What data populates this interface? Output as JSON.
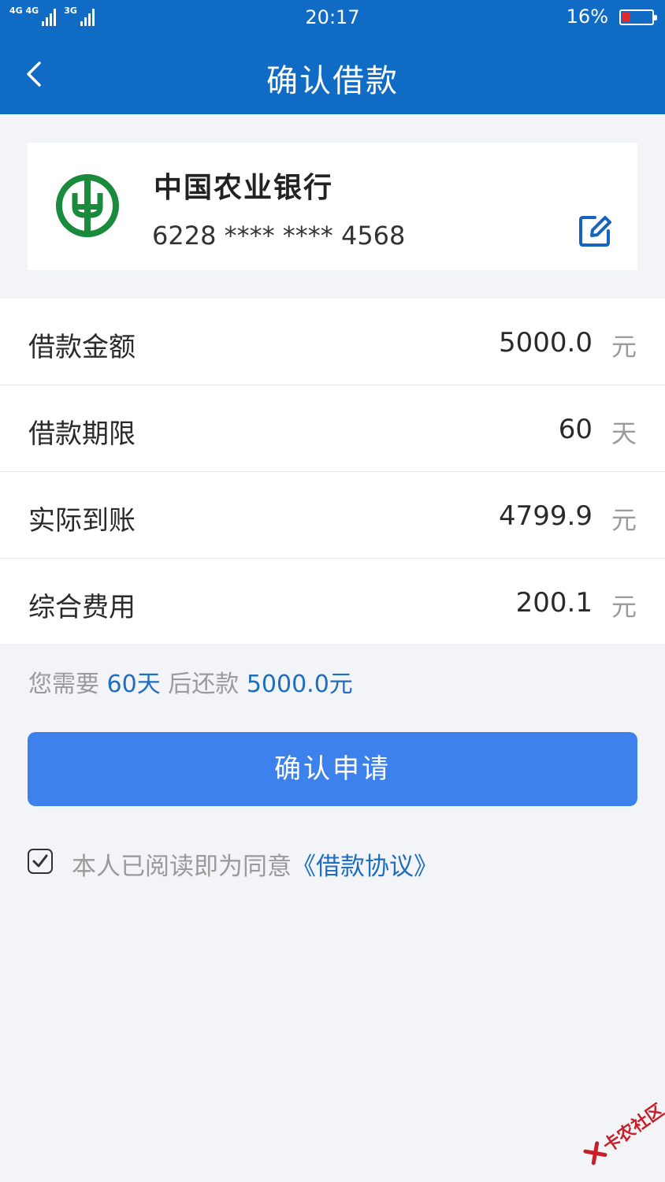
{
  "status_bar": {
    "network1": "4G 4G",
    "network2": "3G",
    "time": "20:17",
    "battery": "16%"
  },
  "nav": {
    "title": "确认借款",
    "back_icon": "chevron-left-icon"
  },
  "bank_card": {
    "bank_name": "中国农业银行",
    "card_number": "6228 **** **** 4568",
    "logo_icon": "abc-bank-logo",
    "edit_icon": "edit-icon",
    "brand_color": "#1a8a3c"
  },
  "details": [
    {
      "label": "借款金额",
      "value": "5000.0",
      "unit": "元"
    },
    {
      "label": "借款期限",
      "value": "60",
      "unit": "天"
    },
    {
      "label": "实际到账",
      "value": "4799.9",
      "unit": "元"
    },
    {
      "label": "综合费用",
      "value": "200.1",
      "unit": "元"
    }
  ],
  "summary": {
    "prefix": "您需要",
    "days": "60天",
    "middle": "后还款",
    "amount": "5000.0元"
  },
  "confirm_button": "确认申请",
  "agreement": {
    "checked": true,
    "text": "本人已阅读即为同意",
    "link": "《借款协议》"
  },
  "watermark": "卡农社区",
  "colors": {
    "header": "#0f6bc4",
    "button": "#3d82ec",
    "highlight": "#1e6ec0",
    "background": "#f3f4f8"
  }
}
